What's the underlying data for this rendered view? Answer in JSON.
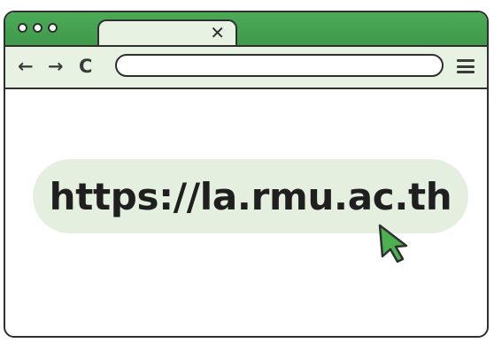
{
  "browser": {
    "tab": {
      "close_glyph": "✕"
    },
    "toolbar": {
      "back_glyph": "←",
      "forward_glyph": "→",
      "reload_glyph": "C"
    },
    "address_bar_value": ""
  },
  "content": {
    "url_text": "https://la.rmu.ac.th"
  },
  "colors": {
    "titlebar_green": "#45a350",
    "light_green": "#e8f2e3",
    "pill_green": "#e5efdf",
    "cursor_green": "#4caf50"
  },
  "icons": [
    "window-dot-icon",
    "close-icon",
    "back-arrow-icon",
    "forward-arrow-icon",
    "reload-icon",
    "hamburger-menu-icon",
    "mouse-cursor-icon"
  ]
}
